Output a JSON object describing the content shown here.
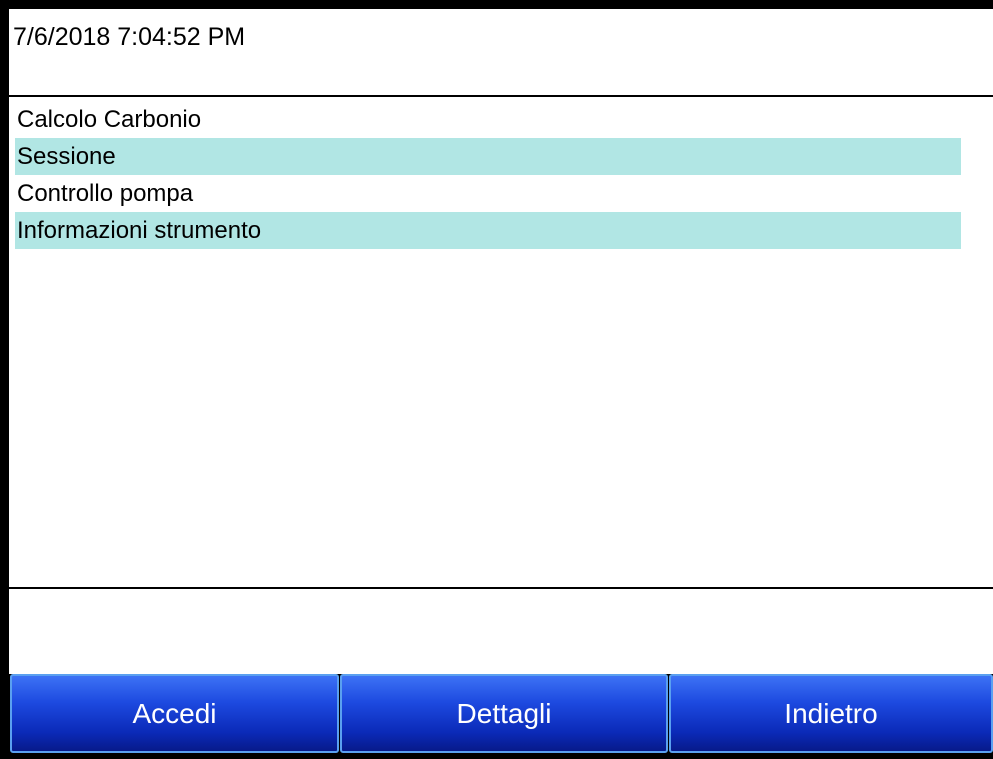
{
  "header": {
    "datetime": "7/6/2018 7:04:52 PM"
  },
  "menu": {
    "items": [
      {
        "label": "Calcolo Carbonio"
      },
      {
        "label": "Sessione"
      },
      {
        "label": "Controllo pompa"
      },
      {
        "label": "Informazioni strumento"
      }
    ]
  },
  "buttons": {
    "accedi_label": "Accedi",
    "dettagli_label": "Dettagli",
    "indietro_label": "Indietro"
  },
  "colors": {
    "row_highlight": "#b1e6e4",
    "button_blue": "#1d4ae0",
    "frame": "#000000"
  }
}
